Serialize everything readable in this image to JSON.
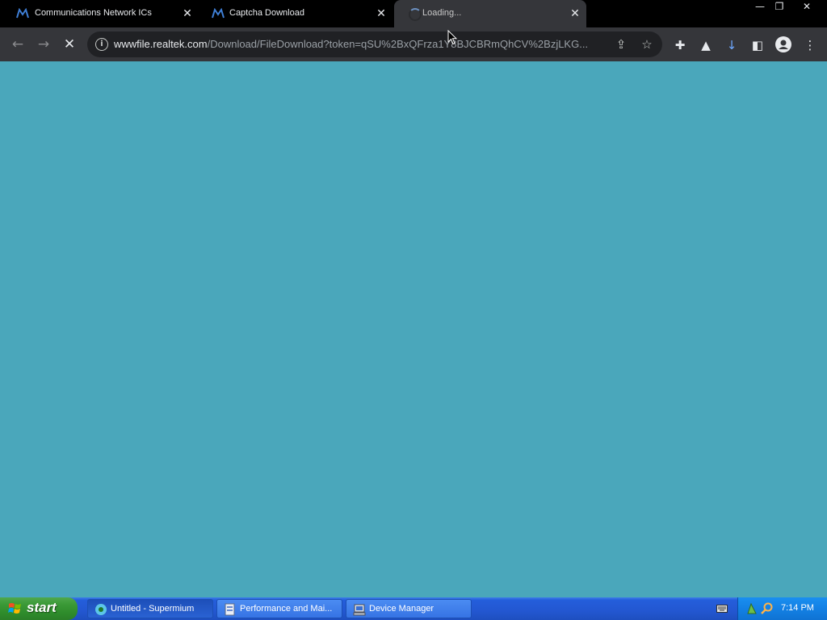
{
  "browser": {
    "tabs": [
      {
        "title": "Communications Network ICs",
        "state": "inactive"
      },
      {
        "title": "Captcha Download",
        "state": "inactive"
      },
      {
        "title": "Loading...",
        "state": "active-loading"
      }
    ],
    "close_glyph": "✕",
    "window_controls": {
      "minimize": "—",
      "restore": "❐",
      "close": "✕"
    },
    "address_bar": {
      "host": "wwwfile.realtek.com",
      "path": "/Download/FileDownload?token=qSU%2BxQFrza1Y8BJCBRmQhCV%2BzjLKG..."
    },
    "toolbar_icons": [
      "back-arrow-icon",
      "forward-arrow-icon",
      "stop-loading-icon",
      "site-info-icon",
      "share-icon",
      "bookmark-star-icon",
      "extensions-icon",
      "labs-flask-icon",
      "download-icon",
      "side-panel-icon",
      "profile-icon",
      "menu-kebab-icon"
    ]
  },
  "content": {
    "background": "#4aa7bb"
  },
  "taskbar": {
    "start_label": "start",
    "items": [
      {
        "label": "Untitled - Supermium",
        "active": true
      },
      {
        "label": "Performance and Mai...",
        "active": false
      },
      {
        "label": "Device Manager",
        "active": false
      }
    ],
    "clock": "7:14 PM"
  }
}
